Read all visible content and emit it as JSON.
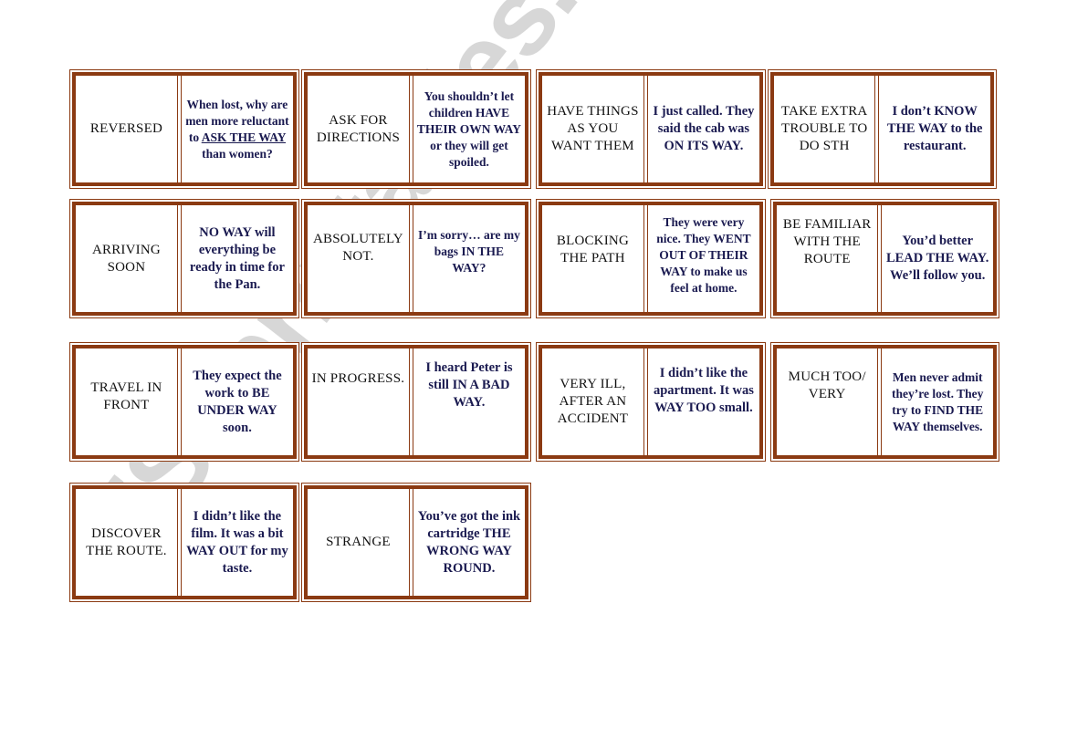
{
  "document": {
    "watermark": "ESLprintables.com",
    "border_color": "#8b3a12",
    "sentence_color": "#1a1a50",
    "cards": [
      {
        "term": "REVERSED",
        "sentence_parts": [
          {
            "text": "When lost, why are men more reluctant to "
          },
          {
            "text": "ASK THE WAY",
            "underline": true
          },
          {
            "text": " than women?"
          }
        ]
      },
      {
        "term": "ASK FOR DIRECTIONS",
        "sentence": "You shouldn’t let children HAVE THEIR OWN WAY or they will get spoiled."
      },
      {
        "term": "HAVE THINGS AS YOU WANT THEM",
        "sentence": "I just called. They said the cab was ON ITS WAY."
      },
      {
        "term": "TAKE EXTRA TROUBLE TO DO STH",
        "sentence": "I don’t KNOW THE WAY to the restaurant."
      },
      {
        "term": "ARRIVING SOON",
        "sentence": "NO WAY will everything be ready in time for the Pan."
      },
      {
        "term": "ABSOLUTELY NOT.",
        "sentence": "I’m sorry… are my bags IN THE WAY?"
      },
      {
        "term": "BLOCKING THE PATH",
        "sentence": "They were very nice. They WENT OUT OF THEIR WAY to make us feel at home."
      },
      {
        "term": "BE FAMILIAR WITH THE ROUTE",
        "sentence": "You’d better LEAD THE WAY. We’ll follow you."
      },
      {
        "term": "TRAVEL IN FRONT",
        "sentence": "They expect the work to BE UNDER WAY soon."
      },
      {
        "term": "IN PROGRESS.",
        "sentence": "I heard Peter is still IN A BAD WAY."
      },
      {
        "term": "VERY ILL, AFTER AN ACCIDENT",
        "sentence": "I didn’t like the apartment. It was WAY TOO small."
      },
      {
        "term": "MUCH TOO/ VERY",
        "sentence": "Men never admit they’re lost. They try to FIND THE WAY themselves."
      },
      {
        "term": "DISCOVER THE ROUTE.",
        "sentence": "I didn’t like the film. It was a bit WAY OUT for my taste."
      },
      {
        "term": "STRANGE",
        "sentence": "You’ve got the ink cartridge THE WRONG WAY ROUND."
      }
    ]
  }
}
